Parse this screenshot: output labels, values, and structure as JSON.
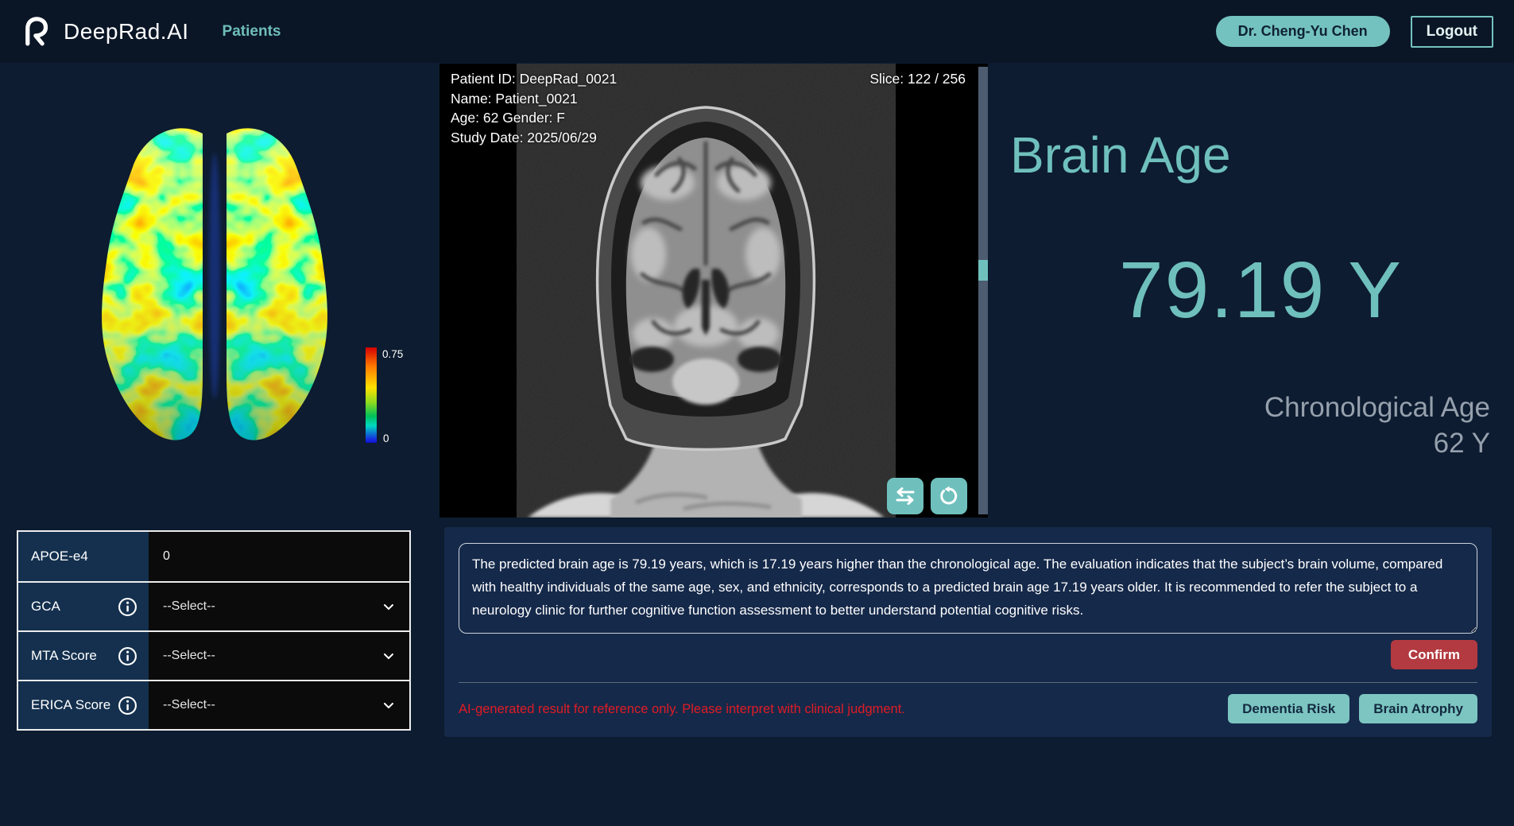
{
  "colors": {
    "accent_teal": "#74c2bf",
    "page_navy": "#0d1c30",
    "navbar_navy": "#0a1626",
    "panel_navy": "#15294a",
    "table_label_blue": "#14304e",
    "confirm_red": "#b23a40",
    "warning_red": "#e01c24"
  },
  "navbar": {
    "logo_text": "DeepRad.AI",
    "nav_patients": "Patients",
    "user_badge": "Dr. Cheng-Yu Chen",
    "logout_label": "Logout"
  },
  "heatmap": {
    "colorbar_max": "0.75",
    "colorbar_min": "0"
  },
  "viewer": {
    "overlay": {
      "patient_id": "Patient ID: DeepRad_0021",
      "name": "Name: Patient_0021",
      "age_gender": "Age: 62 Gender: F",
      "study_date": "Study Date: 2025/06/29"
    },
    "slice_label": "Slice: 122 / 256",
    "icons": {
      "swap": "swap-horizontal-icon",
      "reset": "rotate-counterclockwise-icon"
    }
  },
  "result": {
    "title": "Brain Age",
    "predicted_value": "79.19 Y",
    "chronological_label": "Chronological Age",
    "chronological_value": "62 Y"
  },
  "biomarker_table": {
    "rows": [
      {
        "label": "APOE-e4",
        "value": "0",
        "has_info": false,
        "is_select": false
      },
      {
        "label": "GCA",
        "value": "--Select--",
        "has_info": true,
        "is_select": true
      },
      {
        "label": "MTA Score",
        "value": "--Select--",
        "has_info": true,
        "is_select": true
      },
      {
        "label": "ERICA Score",
        "value": "--Select--",
        "has_info": true,
        "is_select": true
      }
    ]
  },
  "report": {
    "summary": "The predicted brain age is 79.19 years, which is 17.19 years higher than the chronological age. The evaluation indicates that the subject’s brain volume, compared with healthy individuals of the same age, sex, and ethnicity, corresponds to a predicted brain age 17.19 years older. It is recommended to refer the subject to a neurology clinic for further cognitive function assessment to better understand potential cognitive risks.",
    "confirm_label": "Confirm",
    "disclaimer": "AI-generated result for reference only. Please interpret with clinical judgment.",
    "dementia_button": "Dementia Risk",
    "atrophy_button": "Brain Atrophy"
  }
}
